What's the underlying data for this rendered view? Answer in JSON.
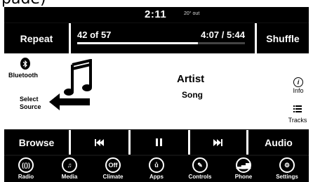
{
  "caption": "pade)",
  "status": {
    "clock": "2:11",
    "temp": "20° out"
  },
  "top": {
    "repeat": "Repeat",
    "count": "42 of 57",
    "time": "4:07 / 5:44",
    "progress": 0.72,
    "shuffle": "Shuffle"
  },
  "main": {
    "bluetooth_label": "Bluetooth",
    "select_source": [
      "Select",
      "Source"
    ],
    "artist": "Artist",
    "song": "Song",
    "info_label": "Info",
    "tracks_label": "Tracks"
  },
  "controls": {
    "browse": "Browse",
    "audio": "Audio"
  },
  "dock": [
    {
      "name": "radio",
      "label": "Radio",
      "icon": "(())"
    },
    {
      "name": "media",
      "label": "Media",
      "icon": "♫"
    },
    {
      "name": "climate",
      "label": "Climate",
      "icon": "Off"
    },
    {
      "name": "apps",
      "label": "Apps",
      "icon": "ů"
    },
    {
      "name": "controls",
      "label": "Controls",
      "icon": "✎"
    },
    {
      "name": "phone",
      "label": "Phone",
      "icon": "▂▄▆"
    },
    {
      "name": "settings",
      "label": "Settings",
      "icon": "⚙"
    }
  ]
}
